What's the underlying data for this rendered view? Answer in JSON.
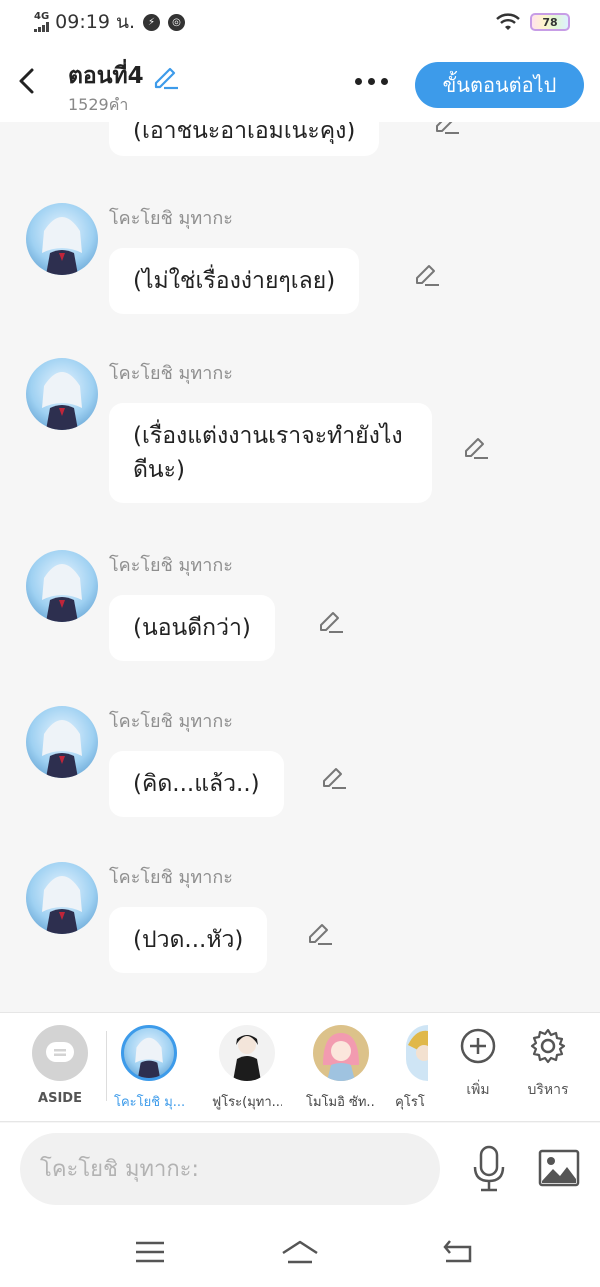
{
  "status_bar": {
    "network": "4G",
    "time": "09:19 น.",
    "battery": "78"
  },
  "header": {
    "title": "ตอนที่4",
    "word_count": "1529คำ",
    "next_button": "ขั้นตอนต่อไป"
  },
  "messages": [
    {
      "speaker": "",
      "text": "(เอาชนะอาเอมเนะคุง)"
    },
    {
      "speaker": "โคะโยชิ มุทากะ",
      "text": "(ไม่ใช่เรื่องง่ายๆเลย)"
    },
    {
      "speaker": "โคะโยชิ มุทากะ",
      "text": "(เรื่องแต่งงานเราจะทำยังไงดีนะ)"
    },
    {
      "speaker": "โคะโยชิ มุทากะ",
      "text": "(นอนดีกว่า)"
    },
    {
      "speaker": "โคะโยชิ มุทากะ",
      "text": "(คิด...แล้ว..)"
    },
    {
      "speaker": "โคะโยชิ มุทากะ",
      "text": "(ปวด...หัว)"
    }
  ],
  "characters": [
    {
      "label": "ASIDE"
    },
    {
      "label": "โคะโยชิ มุ..."
    },
    {
      "label": "ฟูโระ(มุทา..."
    },
    {
      "label": "โมโมอิ ซัท..."
    },
    {
      "label": "คุโรโ"
    }
  ],
  "tools": {
    "add_label": "เพิ่ม",
    "manage_label": "บริหาร"
  },
  "input": {
    "placeholder": "โคะโยชิ มุทากะ:"
  },
  "colors": {
    "accent": "#3d9bea",
    "background": "#f6f6f6"
  }
}
